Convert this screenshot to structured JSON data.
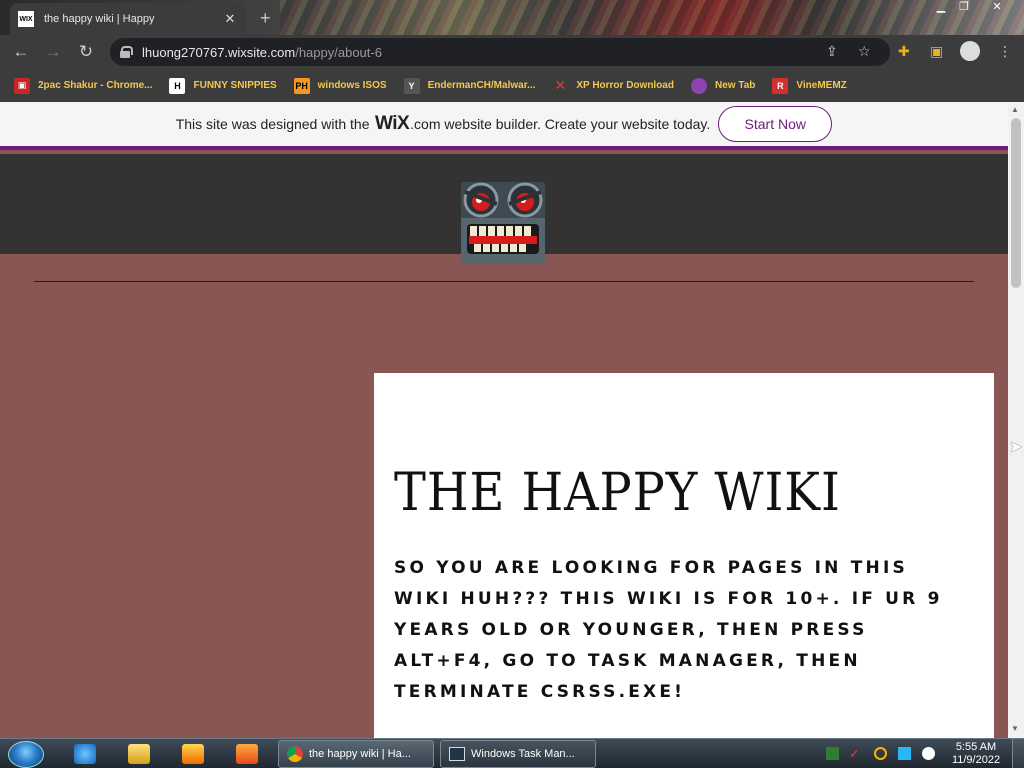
{
  "browser": {
    "tab_title": "the happy wiki | Happy",
    "tab_favicon_text": "WIX",
    "url_host": "lhuong270767.wixsite.com",
    "url_path": "/happy/about-6"
  },
  "bookmarks": [
    {
      "label": "2pac Shakur - Chrome...",
      "icon": "tupac-icon",
      "icon_color": "#c62828"
    },
    {
      "label": "FUNNY SNIPPIES",
      "icon": "h-icon",
      "icon_color": "#222222"
    },
    {
      "label": "windows ISOS",
      "icon": "ph-icon",
      "icon_color": "#f7971d"
    },
    {
      "label": "EndermanCH/Malwar...",
      "icon": "github-icon",
      "icon_color": "#444444"
    },
    {
      "label": "XP Horror Download",
      "icon": "x-icon",
      "icon_color": "#e53935"
    },
    {
      "label": "New Tab",
      "icon": "globe-icon",
      "icon_color": "#8e44ad"
    },
    {
      "label": "VineMEMZ",
      "icon": "vine-icon",
      "icon_color": "#d32f2f"
    }
  ],
  "wix_banner": {
    "prefix": "This site was designed with the",
    "brand": "WiX",
    "suffix": ".com website builder. Create your website today.",
    "cta": "Start Now",
    "accent": "#6e1d7a"
  },
  "page": {
    "heading": "THE HAPPY WIKI",
    "body": "So you are looking for pages in this wiki huh??? this wiki is for 10+. If ur 9 years old or younger, then press alt+f4, go to task manager, then terminate csrss.exe!",
    "background": "#8a5654",
    "header_color": "#333333"
  },
  "taskbar": {
    "items": [
      {
        "label": "the happy wiki | Ha...",
        "icon": "chrome-icon"
      },
      {
        "label": "Windows Task Man...",
        "icon": "task-manager-icon"
      }
    ],
    "time": "5:55 AM",
    "date": "11/9/2022"
  }
}
